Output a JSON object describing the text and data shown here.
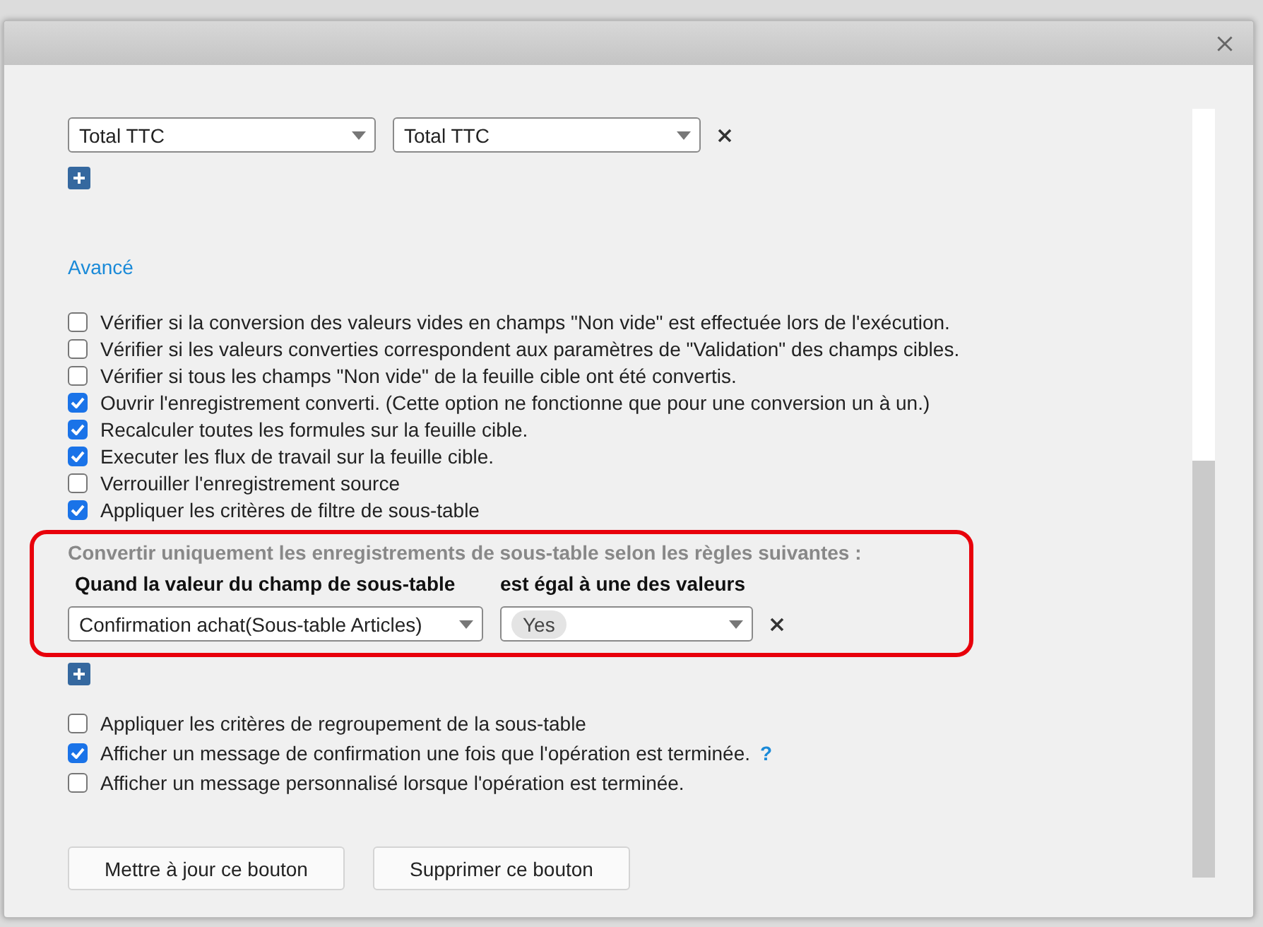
{
  "mappings": [
    {
      "source": "Total TTC",
      "target": "Total TTC"
    }
  ],
  "advanced_title": "Avancé",
  "options": [
    {
      "label": "Vérifier si la conversion des valeurs vides en champs \"Non vide\" est effectuée lors de l'exécution.",
      "checked": false
    },
    {
      "label": "Vérifier si les valeurs converties correspondent aux paramètres de \"Validation\" des champs cibles.",
      "checked": false
    },
    {
      "label": "Vérifier si tous les champs \"Non vide\" de la feuille cible ont été convertis.",
      "checked": false
    },
    {
      "label": "Ouvrir l'enregistrement converti. (Cette option ne fonctionne que pour une conversion un à un.)",
      "checked": true
    },
    {
      "label": "Recalculer toutes les formules sur la feuille cible.",
      "checked": true
    },
    {
      "label": "Executer les flux de travail sur la feuille cible.",
      "checked": true
    },
    {
      "label": "Verrouiller l'enregistrement source",
      "checked": false
    },
    {
      "label": "Appliquer les critères de filtre de sous-table",
      "checked": true
    }
  ],
  "filter": {
    "title": "Convertir uniquement les enregistrements de sous-table selon les règles suivantes :",
    "field_label": "Quand la valeur du champ de sous-table",
    "operator_label": "est égal à une des valeurs",
    "rules": [
      {
        "field": "Confirmation achat(Sous-table Articles)",
        "values": [
          "Yes"
        ]
      }
    ]
  },
  "options_after": [
    {
      "label": "Appliquer les critères de regroupement de la sous-table",
      "checked": false
    },
    {
      "label": "Afficher un message de confirmation une fois que l'opération est terminée.",
      "checked": true,
      "help": "?"
    },
    {
      "label": "Afficher un message personnalisé lorsque l'opération est terminée.",
      "checked": false
    }
  ],
  "buttons": [
    "Mettre à jour ce bouton",
    "Supprimer ce bouton"
  ]
}
